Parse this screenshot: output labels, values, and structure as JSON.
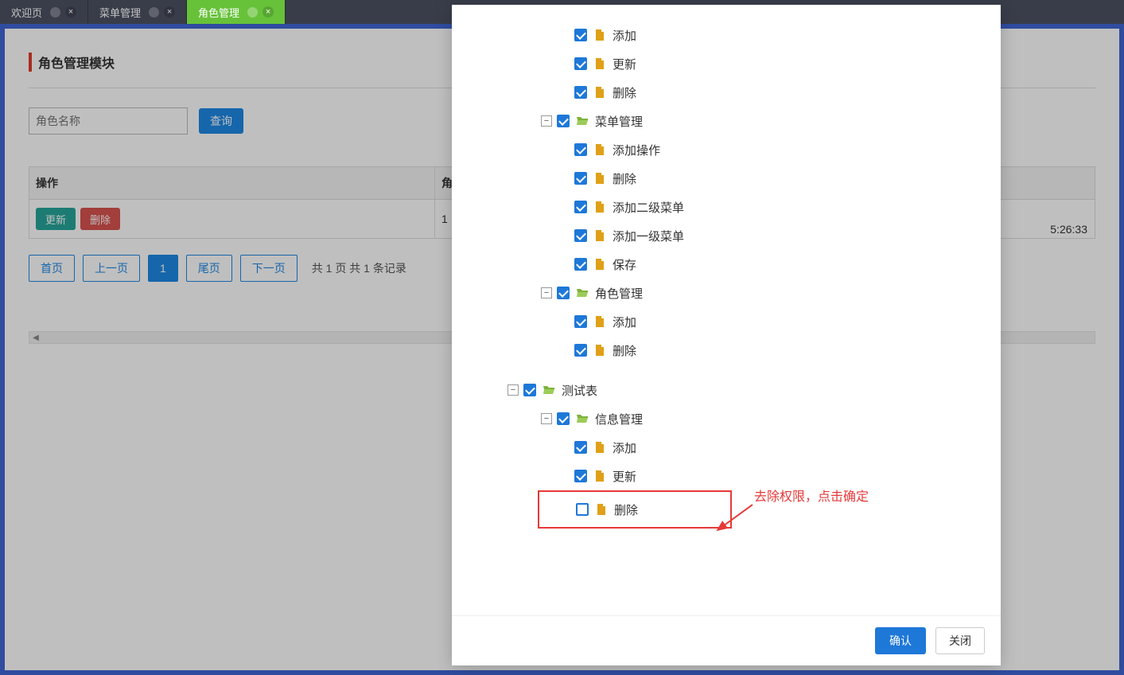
{
  "tabs": [
    {
      "label": "欢迎页",
      "closable": true,
      "active": false
    },
    {
      "label": "菜单管理",
      "closable": true,
      "active": false
    },
    {
      "label": "角色管理",
      "closable": true,
      "active": true
    }
  ],
  "page": {
    "title": "角色管理模块",
    "search_placeholder": "角色名称",
    "search_button": "查询",
    "table": {
      "headers": {
        "op": "操作",
        "role_prefix": "角"
      },
      "row": {
        "update": "更新",
        "delete": "删除",
        "id_prefix": "1",
        "time_suffix": "5:26:33"
      }
    },
    "pager": {
      "first": "首页",
      "prev": "上一页",
      "current": "1",
      "last": "尾页",
      "next": "下一页",
      "summary": "共 1 页 共 1 条记录"
    }
  },
  "modal": {
    "tree": {
      "group1": {
        "items": [
          "添加",
          "更新",
          "删除"
        ]
      },
      "menu": {
        "label": "菜单管理",
        "items": [
          "添加操作",
          "删除",
          "添加二级菜单",
          "添加一级菜单",
          "保存"
        ]
      },
      "role": {
        "label": "角色管理",
        "items": [
          "添加",
          "删除"
        ]
      },
      "test": {
        "label": "测试表",
        "info": {
          "label": "信息管理",
          "items": [
            {
              "label": "添加",
              "checked": true,
              "highlight": false
            },
            {
              "label": "更新",
              "checked": true,
              "highlight": false
            },
            {
              "label": "删除",
              "checked": false,
              "highlight": true
            }
          ]
        }
      }
    },
    "confirm": "确认",
    "close": "关闭"
  },
  "annotation": {
    "text": "去除权限，点击确定"
  }
}
